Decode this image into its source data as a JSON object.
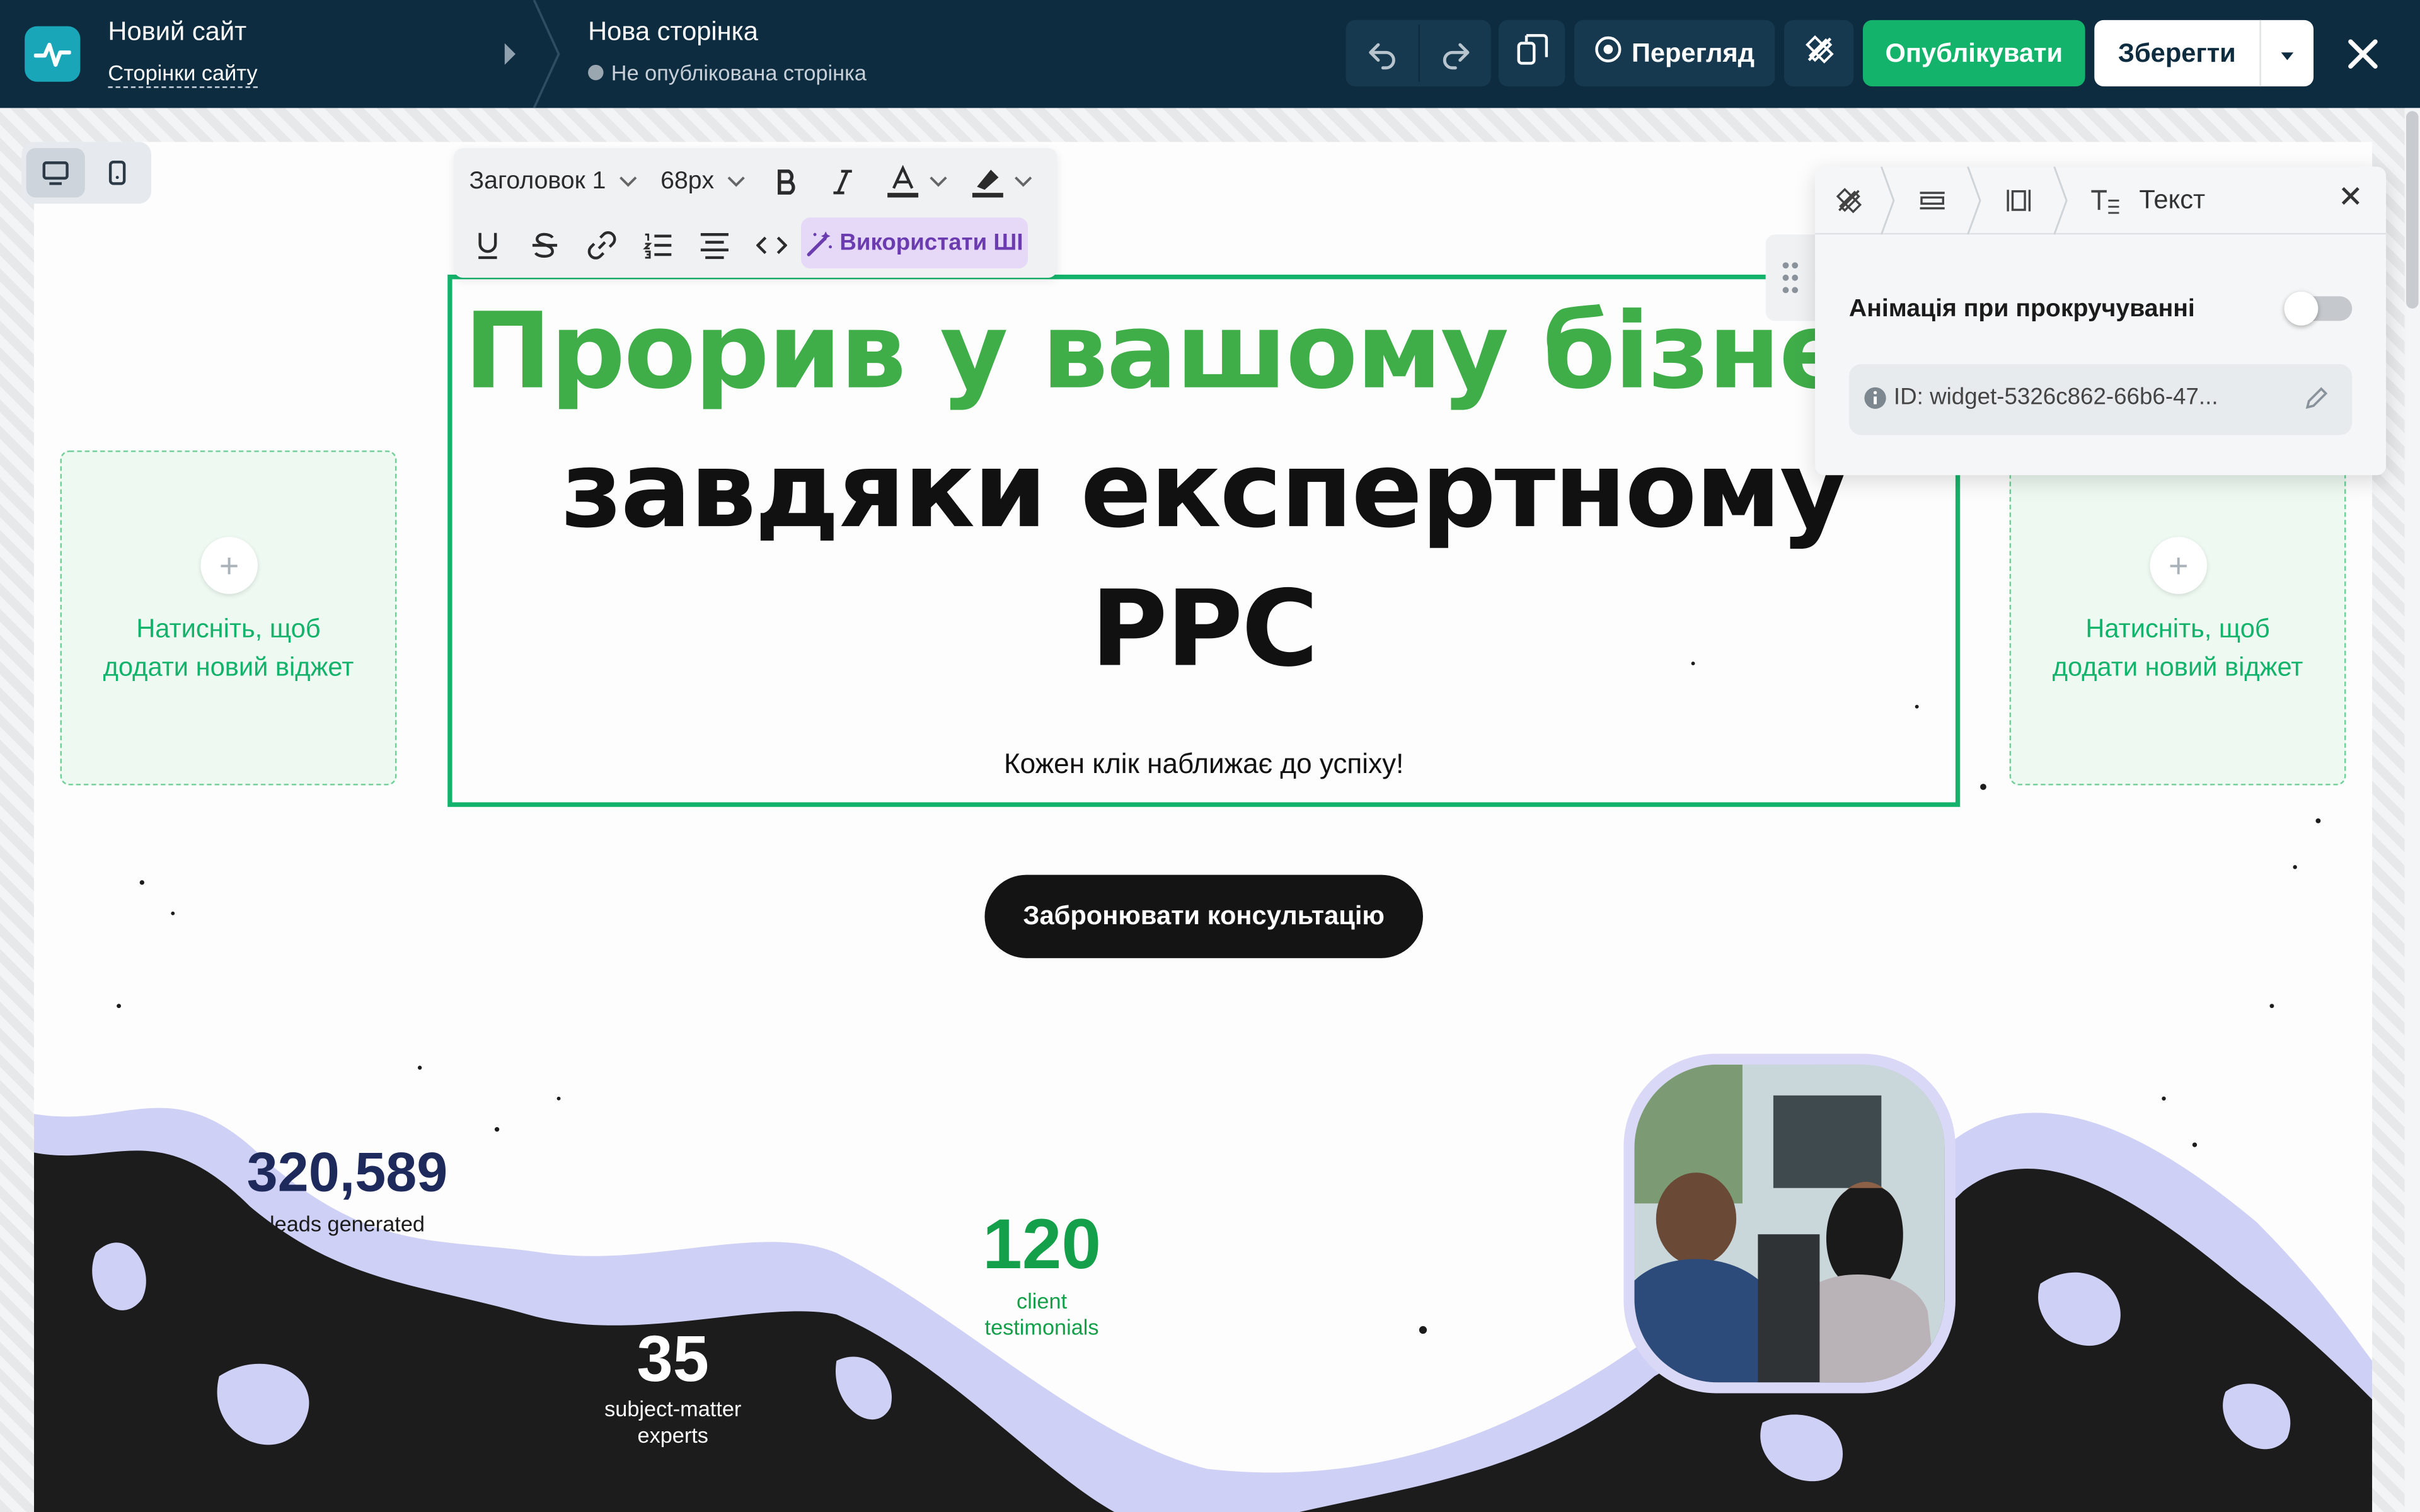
{
  "topbar": {
    "site_title": "Новий сайт",
    "site_pages_link": "Сторінки сайту",
    "page_title": "Нова сторінка",
    "page_status": "Не опублікована сторінка",
    "preview_label": "Перегляд",
    "publish_label": "Опублікувати",
    "save_label": "Зберегти"
  },
  "text_toolbar": {
    "heading_style": "Заголовок 1",
    "font_size": "68px",
    "ai_button": "Використати ШІ"
  },
  "hero": {
    "heading_green": "Прорив у вашому бізнесі",
    "heading_line2": "завдяки експертному",
    "heading_line3": "PPC",
    "subline": "Кожен клік наближає до успіху!",
    "cta_label": "Забронювати консультацію"
  },
  "add_widget": {
    "left_text": "Натисніть, щоб додати новий віджет",
    "right_text": "Натисніть, щоб додати новий віджет"
  },
  "properties_panel": {
    "widget_type": "Текст",
    "scroll_animation_label": "Анімація при прокручуванні",
    "scroll_animation_enabled": false,
    "widget_id": "ID: widget-5326c862-66b6-47..."
  },
  "stats": [
    {
      "value": "320,589",
      "label": "leads generated",
      "color": "#1f2a5c",
      "bg": "#e8e8fb"
    },
    {
      "value": "120",
      "label": "client testimonials",
      "color": "#14a04a",
      "bg": "#e4f9e8"
    },
    {
      "value": "35",
      "label": "subject-matter experts",
      "color": "#ffffff",
      "bg": "#e25bc8"
    }
  ],
  "colors": {
    "topbar_bg": "#0e2c40",
    "accent_green": "#14b36b",
    "heading_green": "#3fae49",
    "ai_purple": "#6a3cb0"
  },
  "icons": [
    "logo-icon",
    "undo-icon",
    "redo-icon",
    "layers-icon",
    "eye-icon",
    "design-tools-icon",
    "close-icon",
    "desktop-icon",
    "mobile-icon",
    "bold-icon",
    "italic-icon",
    "text-color-icon",
    "highlight-icon",
    "underline-icon",
    "strikethrough-icon",
    "link-icon",
    "ordered-list-icon",
    "align-center-icon",
    "code-icon",
    "magic-wand-icon",
    "drag-handle-icon",
    "info-icon",
    "pencil-icon"
  ]
}
